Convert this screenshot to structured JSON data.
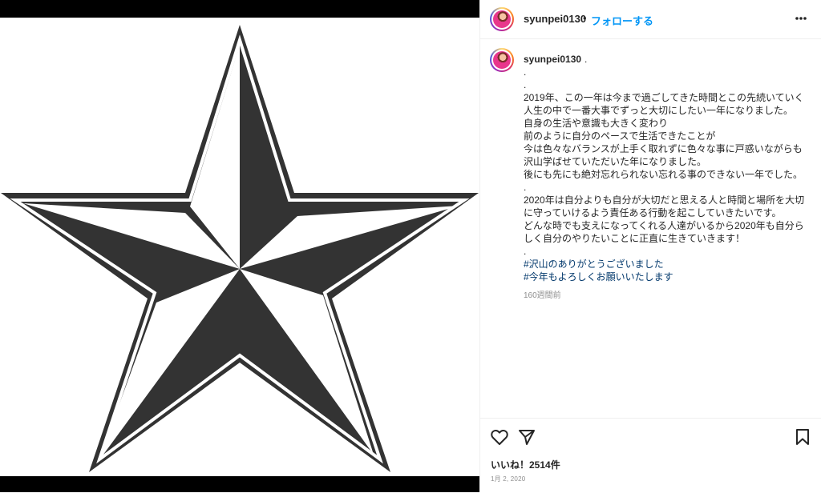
{
  "post": {
    "username": "syunpei0130",
    "dot": "•",
    "follow_label": "フォローする",
    "more_icon": "more-horizontal-icon"
  },
  "caption": {
    "username": "syunpei0130",
    "text": ".\n.\n.\n2019年、この一年は今まで過ごしてきた時間とこの先続いていく人生の中で一番大事でずっと大切にしたい一年になりました。\n自身の生活や意識も大きく変わり\n前のように自分のペースで生活できたことが\n今は色々なバランスが上手く取れずに色々な事に戸惑いながらも沢山学ばせていただいた年になりました。\n後にも先にも絶対忘れられない忘れる事のできない一年でした。\n.\n2020年は自分よりも自分が大切だと思える人と時間と場所を大切に守っていけるよう責任ある行動を起こしていきたいです。\nどんな時でも支えになってくれる人達がいるから2020年も自分らしく自分のやりたいことに正直に生きていきます！\n.",
    "hashtags": [
      "#沢山のありがとうございました",
      "#今年もよろしくお願いいたします"
    ],
    "time_ago": "160週間前"
  },
  "actions": {
    "like_icon": "heart-icon",
    "share_icon": "send-icon",
    "save_icon": "bookmark-icon",
    "likes_text": "いいね！2514件",
    "date": "1月 2, 2020"
  },
  "colors": {
    "accent": "#0095f6",
    "hashtag": "#00376b",
    "star": "#333333"
  }
}
